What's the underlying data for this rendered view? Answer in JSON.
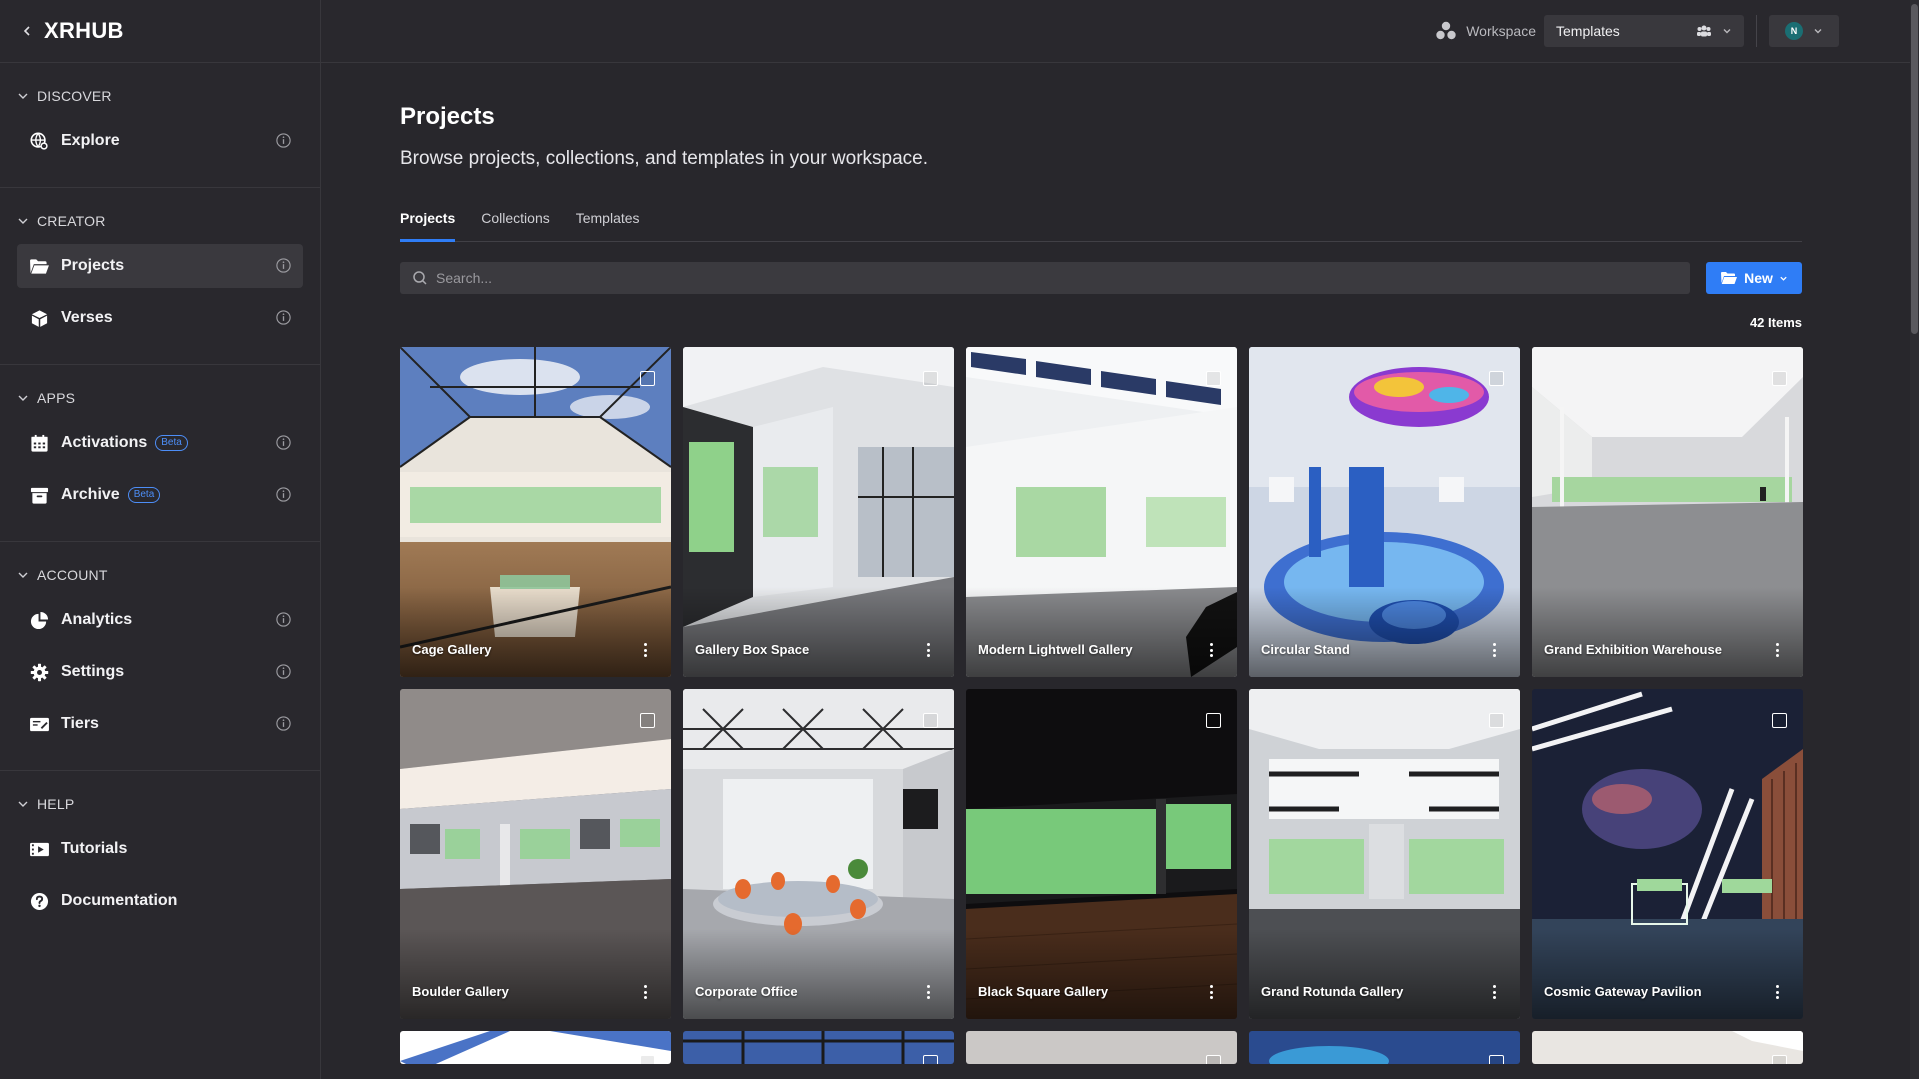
{
  "brand": {
    "name": "XRHUB"
  },
  "sidebar": {
    "sections": [
      {
        "title": "DISCOVER",
        "items": [
          {
            "label": "Explore",
            "icon": "globe-icon"
          }
        ]
      },
      {
        "title": "CREATOR",
        "items": [
          {
            "label": "Projects",
            "icon": "folder-icon",
            "active": true
          },
          {
            "label": "Verses",
            "icon": "cube-icon"
          }
        ]
      },
      {
        "title": "APPS",
        "items": [
          {
            "label": "Activations",
            "icon": "calendar-icon",
            "badge": "Beta"
          },
          {
            "label": "Archive",
            "icon": "archive-icon",
            "badge": "Beta"
          }
        ]
      },
      {
        "title": "ACCOUNT",
        "items": [
          {
            "label": "Analytics",
            "icon": "pie-chart-icon"
          },
          {
            "label": "Settings",
            "icon": "gear-icon"
          },
          {
            "label": "Tiers",
            "icon": "ticket-icon"
          }
        ]
      },
      {
        "title": "HELP",
        "items": [
          {
            "label": "Tutorials",
            "icon": "video-icon"
          },
          {
            "label": "Documentation",
            "icon": "question-icon"
          }
        ]
      }
    ]
  },
  "topbar": {
    "workspace_label": "Workspace",
    "workspace_value": "Templates",
    "avatar_initial": "N"
  },
  "main": {
    "title": "Projects",
    "subtitle": "Browse projects, collections, and templates in your workspace.",
    "tabs": [
      {
        "label": "Projects",
        "active": true
      },
      {
        "label": "Collections"
      },
      {
        "label": "Templates"
      }
    ],
    "search_placeholder": "Search...",
    "new_label": "New",
    "count": "42 Items"
  },
  "cards": [
    {
      "name": "Cage Gallery",
      "scene": "cage"
    },
    {
      "name": "Gallery Box Space",
      "scene": "box"
    },
    {
      "name": "Modern Lightwell Gallery",
      "scene": "lightwell"
    },
    {
      "name": "Circular Stand",
      "scene": "circular"
    },
    {
      "name": "Grand Exhibition Warehouse",
      "scene": "warehouse"
    },
    {
      "name": "Boulder Gallery",
      "scene": "boulder"
    },
    {
      "name": "Corporate Office",
      "scene": "office"
    },
    {
      "name": "Black Square Gallery",
      "scene": "blacksquare"
    },
    {
      "name": "Grand Rotunda Gallery",
      "scene": "rotunda"
    },
    {
      "name": "Cosmic Gateway Pavilion",
      "scene": "cosmic"
    }
  ],
  "colors": {
    "accent": "#2f7df6",
    "bg": "#28272c",
    "sidebar": "#29282d"
  }
}
